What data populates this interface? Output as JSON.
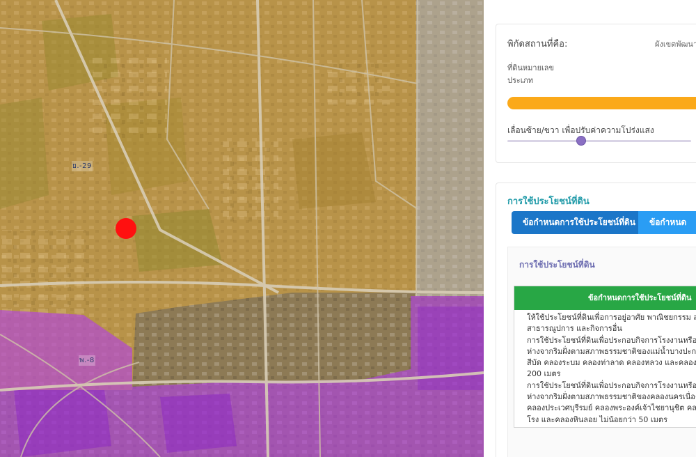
{
  "map": {
    "zone_labels": [
      "ย.-29",
      "พ.-8"
    ],
    "colors": {
      "imagery": "#8d7a55",
      "zone_yellow": "#f2b53a",
      "zone_purple": "#b13fe8",
      "marker": "#ff1010"
    }
  },
  "panel": {
    "coord_label": "พิกัดสถานที่คือ:",
    "coord_source": "ผังเขตพัฒนาฯ",
    "parcel_label": "ที่ดินหมายเลข",
    "type_label": "ประเภท",
    "slider_hint": "เลื่อนซ้าย/ขวา เพื่อปรับค่าความโปร่งแสง",
    "opacity_value": 0.4,
    "landuse_title": "การใช้ประโยชน์ที่ดิน",
    "tabs": [
      "ข้อกำหนดการใช้ประโยชน์ที่ดิน",
      "ข้อกำหนด"
    ],
    "inner_title": "การใช้ประโยชน์ที่ดิน",
    "table_header": "ข้อกำหนดการใช้ประโยชน์ที่ดิน",
    "table_lines": [
      "ให้ใช้ประโยชน์ที่ดินเพื่อการอยู่อาศัย พาณิชยกรรม สาธ",
      "สาธารณูปการ และกิจการอื่น",
      "การใช้ประโยชน์ที่ดินเพื่อประกอบกิจการโรงงานหรือค",
      "ห่างจากริมฝั่งตามสภาพธรรมชาติของแม่น้ำบางปะกง",
      "สีบัด คลองระบม คลองท่าลาด คลองหลวง และคลอง",
      "200 เมตร",
      "การใช้ประโยชน์ที่ดินเพื่อประกอบกิจการโรงงานหรือค",
      "ห่างจากริมฝั่งตามสภาพธรรมชาติของคลองนครเนื่องเ",
      "คลองประเวศบุรีรมย์ คลองพระองค์เจ้าไชยานุชิต คลอง",
      "โรง และคลองหินลอย ไม่น้อยกว่า 50 เมตร"
    ],
    "colors": {
      "bar": "#fba919",
      "tab_active": "#1b76c8",
      "tab_secondary": "#2a9df4",
      "table_header": "#28a745",
      "title": "#1f9aa8"
    }
  }
}
